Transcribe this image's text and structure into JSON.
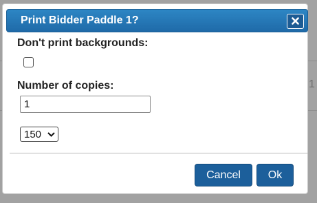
{
  "dialog": {
    "title": "Print Bidder Paddle 1?",
    "close_icon": "close-icon",
    "background_label": "Don't print backgrounds:",
    "background_checked": false,
    "copies_label": "Number of copies:",
    "copies_value": "1",
    "size_select_value": "150",
    "cancel_label": "Cancel",
    "ok_label": "Ok"
  },
  "background": {
    "partial_digit": "1"
  },
  "colors": {
    "titlebar": "#1f6aa8",
    "button": "#1c5f9b",
    "backdrop": "#a2a2a2"
  }
}
